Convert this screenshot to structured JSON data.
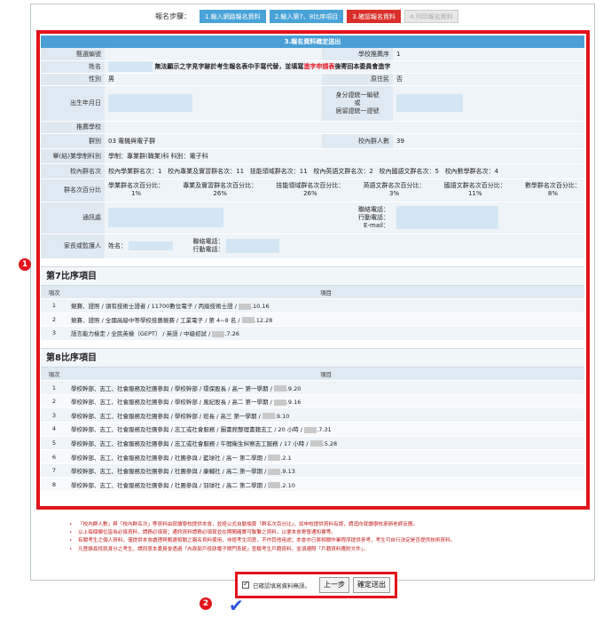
{
  "steps": {
    "label": "報名步驟：",
    "items": [
      {
        "label": "1.輸入網路報名資料",
        "state": "done"
      },
      {
        "label": "2.輸入第7、8比序項目",
        "state": "done"
      },
      {
        "label": "3.確認報名資料",
        "state": "current"
      },
      {
        "label": "4.列印報名資料",
        "state": "disabled"
      }
    ]
  },
  "confirm_section": {
    "title": "3.報名資料確定送出",
    "rows": {
      "serial_label": "甄選編號",
      "school_rec_label": "學校推薦序",
      "school_rec_value": "1",
      "name_label": "姓名",
      "name_note_prefix": "無法顯示之字見字跡於考生報名表中手寫代替，並填寫",
      "name_note_red": "造字申請表",
      "name_note_suffix": "後寄回本委員會造字",
      "gender_label": "性別",
      "gender_value": "男",
      "aboriginal_label": "原住民",
      "aboriginal_value": "否",
      "birth_label": "出生年月日",
      "id_label_1": "身分證統一編號",
      "id_label_2": "或",
      "id_label_3": "居留證統一證號",
      "school_label": "推薦學校",
      "group_label": "群別",
      "group_value": "03 電機與電子群",
      "school_count_label": "校內群人數",
      "school_count_value": "39",
      "program_label": "畢(結)業學制科別",
      "program_value": "學制：專業群(職業)科  科別：電子科",
      "rank_label": "校內群名次",
      "rank_values": [
        "校內學業群名次：1",
        "校內專業及實習群名次：11",
        "技能領域群名次：11",
        "校內英語文群名次：2",
        "校內國語文群名次：5",
        "校內數學群名次：4"
      ],
      "pct_label": "群名次百分比",
      "pct_items": [
        {
          "label": "學業群名次百分比：",
          "value": "1%"
        },
        {
          "label": "專業及實習群名次百分比：",
          "value": "26%"
        },
        {
          "label": "技能領域群名次百分比：",
          "value": "26%"
        },
        {
          "label": "英語文群名次百分比：",
          "value": "3%"
        },
        {
          "label": "國語文群名次百分比：",
          "value": "11%"
        },
        {
          "label": "數學群名次百分比：",
          "value": "8%"
        }
      ],
      "address_label": "通訊處",
      "phone_label": "聯絡電話：",
      "mobile_label": "行動電話：",
      "email_label": "E-mail：",
      "guardian_label": "家長或監護人",
      "guardian_name_label": "姓名：",
      "guardian_phone_label": "聯絡電話：",
      "guardian_mobile_label": "行動電話："
    }
  },
  "section7": {
    "title": "第7比序項目",
    "headers": [
      "項次",
      "項目"
    ],
    "rows": [
      {
        "no": "1",
        "pre": "競賽、證照 / 領有技術士證者 / 11700數位電子 / 丙級技術士證 / ",
        "post": ".10.16"
      },
      {
        "no": "2",
        "pre": "競賽、證照 / 全國高級中等學校技藝競賽 / 工業電子 / 第 4~8 名 / ",
        "post": ".12.28"
      },
      {
        "no": "3",
        "pre": "語言能力檢定 / 全民英檢（GEPT） / 英語 / 中級初試 / ",
        "post": ".7.26"
      }
    ]
  },
  "section8": {
    "title": "第8比序項目",
    "headers": [
      "項次",
      "項目"
    ],
    "rows": [
      {
        "no": "1",
        "pre": "學校幹部、志工、社會服務及社團參與 / 學校幹部 / 環保股長 / 高一 第一學期 / ",
        "post": ".9.20"
      },
      {
        "no": "2",
        "pre": "學校幹部、志工、社會服務及社團參與 / 學校幹部 / 風紀股長 / 高二 第一學期 / ",
        "post": ".9.16"
      },
      {
        "no": "3",
        "pre": "學校幹部、志工、社會服務及社團參與 / 學校幹部 / 班長 / 高三 第一學期 / ",
        "post": ".9.10"
      },
      {
        "no": "4",
        "pre": "學校幹部、志工、社會服務及社團參與 / 志工或社會服務 / 圖書館整理書籍志工 / 20 小時 / ",
        "post": ".7.31"
      },
      {
        "no": "5",
        "pre": "學校幹部、志工、社會服務及社團參與 / 志工或社會服務 / 午間衛生糾察志工服務 / 17 小時 / ",
        "post": ".5.28"
      },
      {
        "no": "6",
        "pre": "學校幹部、志工、社會服務及社團參與 / 社團參與 / 籃球社 / 高一 第二學期 / ",
        "post": ".2.1"
      },
      {
        "no": "7",
        "pre": "學校幹部、志工、社會服務及社團參與 / 社團參與 / 康輔社 / 高二 第一學期 / ",
        "post": ".9.13"
      },
      {
        "no": "8",
        "pre": "學校幹部、志工、社會服務及社團參與 / 社團參與 / 羽球社 / 高二 第二學期 / ",
        "post": ".2.10"
      }
    ]
  },
  "notes": [
    "「校內群人數」與「校內群名次」等資料由就讀學校提供本會，並經公式自動換算「群名次百分比」，如申校提供資料有誤，請逕向就讀學校承辦老師反應。",
    "以上每個欄位皆為必填資料，請務必填寫；通訊資料請務必填寫並在期間確實可聯繫之資料，以便本會寄發通知書等。",
    "有關考生之個人資料，僅提供本會處理與甄選相關之報名資料使用，非經考生同意，不作其他用途；本會亦已將相關作業程序提供參考，考生可自行決定是否提供技術資料。",
    "凡登錄尋找就身分之考生，請同意本委員會透過「內政部戶役政電子閘門系統」查驗考生戶籍資料，並須遵照「戶籍資料應附文件」。"
  ],
  "confirm": {
    "checkbox_label": "已確認填寫資料無誤。",
    "prev_button": "上一步",
    "submit_button": "確定送出"
  },
  "markers": {
    "m1": "1",
    "m2": "2"
  },
  "colors": {
    "highlight": "#e2141c",
    "header_blue": "#4a9fd6",
    "row_label": "#dfe9f1",
    "row_value": "#eef4f8"
  }
}
